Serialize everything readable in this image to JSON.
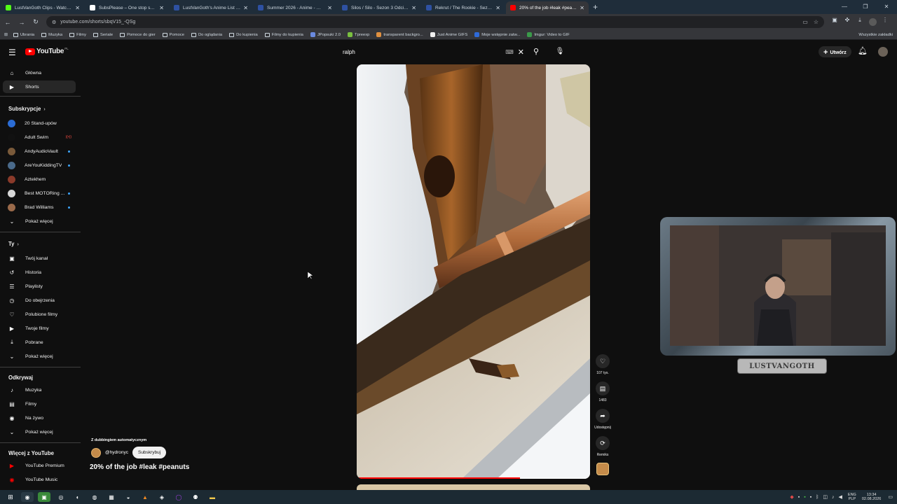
{
  "browser": {
    "tabs": [
      {
        "title": "LustVanGoth Clips - Watch Live",
        "color": "#53fc18",
        "active": false
      },
      {
        "title": "SubsPlease – One stop shop fo",
        "color": "#ffffff",
        "active": false
      },
      {
        "title": "LustVanGoth's Anime List - My",
        "color": "#2e51a2",
        "active": false
      },
      {
        "title": "Summer 2026 - Anime - MyAni",
        "color": "#2e51a2",
        "active": false
      },
      {
        "title": "Silos / Silo - Sezon 3 Odcinek 2",
        "color": "#2e51a2",
        "active": false
      },
      {
        "title": "Rekrut / The Rookie - Sezon 2",
        "color": "#2e51a2",
        "active": false
      },
      {
        "title": "20% of the job #leak #peanu",
        "color": "#ff0000",
        "active": true
      }
    ],
    "url": "youtube.com/shorts/sbqV15_-QSg",
    "bookmarks": [
      "Ubrania",
      "Muzyka",
      "Filmy",
      "Seriale",
      "Pomoce do gier",
      "Pomoce",
      "Do oglądania",
      "Do kupienia",
      "Filmy do kupienia",
      "JPopsuki 2.0",
      "Tpreexp",
      "transparent backgro...",
      "Just Anime GIFS",
      "Moje wstępnie zatw...",
      "Imgur: Video to GIF"
    ],
    "bookmarks_all": "Wszystkie zakładki"
  },
  "youtube": {
    "logo_text": "YouTube",
    "country": "PL",
    "search_query": "ralph",
    "create_label": "Utwórz",
    "sidebar": {
      "main": [
        {
          "label": "Główna",
          "icon": "home-icon"
        },
        {
          "label": "Shorts",
          "icon": "shorts-icon"
        }
      ],
      "subs_title": "Subskrypcje",
      "subs": [
        {
          "label": "20 Stand-upów",
          "color": "#2b6cd4",
          "badge": ""
        },
        {
          "label": "Adult Swim",
          "color": "#111111",
          "badge": "live"
        },
        {
          "label": "AndyAudioVault",
          "color": "#7a5a3a",
          "badge": "dot"
        },
        {
          "label": "AreYouKiddingTV",
          "color": "#4a6a8a",
          "badge": "dot"
        },
        {
          "label": "Aztekhem",
          "color": "#8a3a2a",
          "badge": ""
        },
        {
          "label": "Best MOTORing ...",
          "color": "#d8d8d8",
          "badge": "dot"
        },
        {
          "label": "Brad Williams",
          "color": "#9a6a4a",
          "badge": "dot"
        }
      ],
      "subs_more": "Pokaż więcej",
      "you_title": "Ty",
      "you": [
        {
          "label": "Twój kanał",
          "icon": "channel-icon"
        },
        {
          "label": "Historia",
          "icon": "history-icon"
        },
        {
          "label": "Playlisty",
          "icon": "playlist-icon"
        },
        {
          "label": "Do obejrzenia",
          "icon": "watch-later-icon"
        },
        {
          "label": "Polubione filmy",
          "icon": "like-icon"
        },
        {
          "label": "Twoje filmy",
          "icon": "video-icon"
        },
        {
          "label": "Pobrane",
          "icon": "download-icon"
        }
      ],
      "you_more": "Pokaż więcej",
      "explore_title": "Odkrywaj",
      "explore": [
        {
          "label": "Muzyka",
          "icon": "music-icon"
        },
        {
          "label": "Filmy",
          "icon": "film-icon"
        },
        {
          "label": "Na żywo",
          "icon": "live-icon"
        }
      ],
      "explore_more": "Pokaż więcej",
      "more_title": "Więcej z YouTube",
      "more": [
        {
          "label": "YouTube Premium",
          "icon": "premium-icon"
        },
        {
          "label": "YouTube Music",
          "icon": "music-app-icon"
        }
      ]
    },
    "short": {
      "dubbing": "Z dubbingiem automatycznym",
      "channel": "@hydronyc",
      "subscribe": "Subskrybuj",
      "title": "20% of the job #leak #peanuts",
      "progress": 0.7,
      "likes": "107 tys.",
      "comments": "1483",
      "share": "Udostępnij",
      "remix": "Remiks"
    }
  },
  "overlay": {
    "logo_text": "LUSTVANGOTH"
  },
  "taskbar": {
    "lang_top": "ENG",
    "lang_bottom": "PLP",
    "time": "13:34",
    "date": "02.08.2026"
  }
}
